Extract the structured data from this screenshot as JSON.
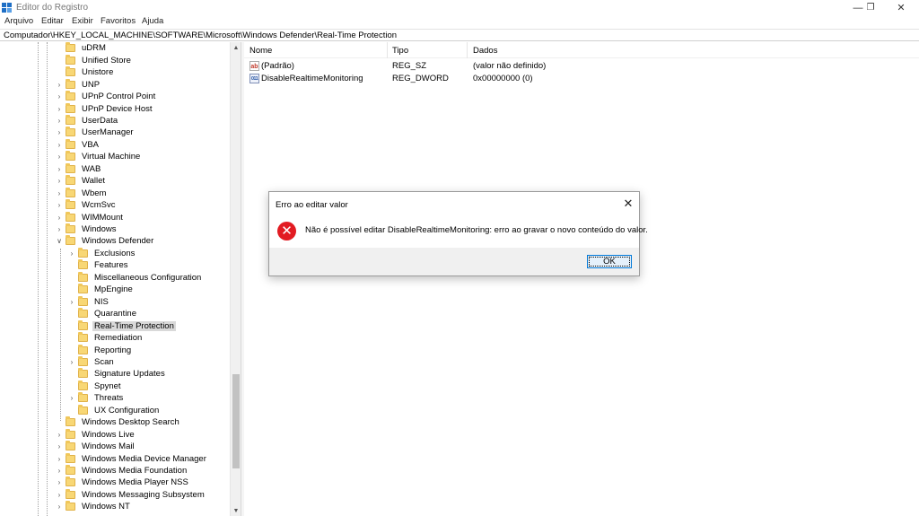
{
  "window": {
    "title": "Editor do Registro",
    "minimize_glyph": "—",
    "restore_glyph": "❐",
    "close_glyph": "✕"
  },
  "menu": [
    "Arquivo",
    "Editar",
    "Exibir",
    "Favoritos",
    "Ajuda"
  ],
  "address": "Computador\\HKEY_LOCAL_MACHINE\\SOFTWARE\\Microsoft\\Windows Defender\\Real-Time Protection",
  "tree": {
    "items": [
      {
        "label": "uDRM",
        "level": 0,
        "expander": ""
      },
      {
        "label": "Unified Store",
        "level": 0,
        "expander": ""
      },
      {
        "label": "Unistore",
        "level": 0,
        "expander": ""
      },
      {
        "label": "UNP",
        "level": 0,
        "expander": "›"
      },
      {
        "label": "UPnP Control Point",
        "level": 0,
        "expander": "›"
      },
      {
        "label": "UPnP Device Host",
        "level": 0,
        "expander": "›"
      },
      {
        "label": "UserData",
        "level": 0,
        "expander": "›"
      },
      {
        "label": "UserManager",
        "level": 0,
        "expander": "›"
      },
      {
        "label": "VBA",
        "level": 0,
        "expander": "›"
      },
      {
        "label": "Virtual Machine",
        "level": 0,
        "expander": "›"
      },
      {
        "label": "WAB",
        "level": 0,
        "expander": "›"
      },
      {
        "label": "Wallet",
        "level": 0,
        "expander": "›"
      },
      {
        "label": "Wbem",
        "level": 0,
        "expander": "›"
      },
      {
        "label": "WcmSvc",
        "level": 0,
        "expander": "›"
      },
      {
        "label": "WIMMount",
        "level": 0,
        "expander": "›"
      },
      {
        "label": "Windows",
        "level": 0,
        "expander": "›"
      },
      {
        "label": "Windows Defender",
        "level": 0,
        "expander": "∨"
      },
      {
        "label": "Exclusions",
        "level": 1,
        "expander": "›"
      },
      {
        "label": "Features",
        "level": 1,
        "expander": ""
      },
      {
        "label": "Miscellaneous Configuration",
        "level": 1,
        "expander": ""
      },
      {
        "label": "MpEngine",
        "level": 1,
        "expander": ""
      },
      {
        "label": "NIS",
        "level": 1,
        "expander": "›"
      },
      {
        "label": "Quarantine",
        "level": 1,
        "expander": ""
      },
      {
        "label": "Real-Time Protection",
        "level": 1,
        "expander": "",
        "selected": true
      },
      {
        "label": "Remediation",
        "level": 1,
        "expander": ""
      },
      {
        "label": "Reporting",
        "level": 1,
        "expander": ""
      },
      {
        "label": "Scan",
        "level": 1,
        "expander": "›"
      },
      {
        "label": "Signature Updates",
        "level": 1,
        "expander": ""
      },
      {
        "label": "Spynet",
        "level": 1,
        "expander": ""
      },
      {
        "label": "Threats",
        "level": 1,
        "expander": "›"
      },
      {
        "label": "UX Configuration",
        "level": 1,
        "expander": ""
      },
      {
        "label": "Windows Desktop Search",
        "level": 0,
        "expander": ""
      },
      {
        "label": "Windows Live",
        "level": 0,
        "expander": "›"
      },
      {
        "label": "Windows Mail",
        "level": 0,
        "expander": "›"
      },
      {
        "label": "Windows Media Device Manager",
        "level": 0,
        "expander": "›"
      },
      {
        "label": "Windows Media Foundation",
        "level": 0,
        "expander": "›"
      },
      {
        "label": "Windows Media Player NSS",
        "level": 0,
        "expander": "›"
      },
      {
        "label": "Windows Messaging Subsystem",
        "level": 0,
        "expander": "›"
      },
      {
        "label": "Windows NT",
        "level": 0,
        "expander": "›"
      }
    ]
  },
  "list": {
    "columns": [
      "Nome",
      "Tipo",
      "Dados"
    ],
    "rows": [
      {
        "icon": "string-value-icon",
        "icon_glyph": "ab",
        "name": "(Padrão)",
        "type": "REG_SZ",
        "data": "(valor não definido)"
      },
      {
        "icon": "binary-value-icon",
        "icon_glyph": "011",
        "name": "DisableRealtimeMonitoring",
        "type": "REG_DWORD",
        "data": "0x00000000 (0)"
      }
    ]
  },
  "dialog": {
    "title": "Erro ao editar valor",
    "message": "Não é possível editar DisableRealtimeMonitoring: erro ao gravar o novo conteúdo do valor.",
    "ok_label": "OK",
    "close_glyph": "✕",
    "icon_glyph": "✕"
  },
  "colors": {
    "error_red": "#e21b22",
    "folder_yellow": "#f8d775",
    "selection_gray": "#d9d9d9",
    "focus_blue": "#0078d7"
  }
}
